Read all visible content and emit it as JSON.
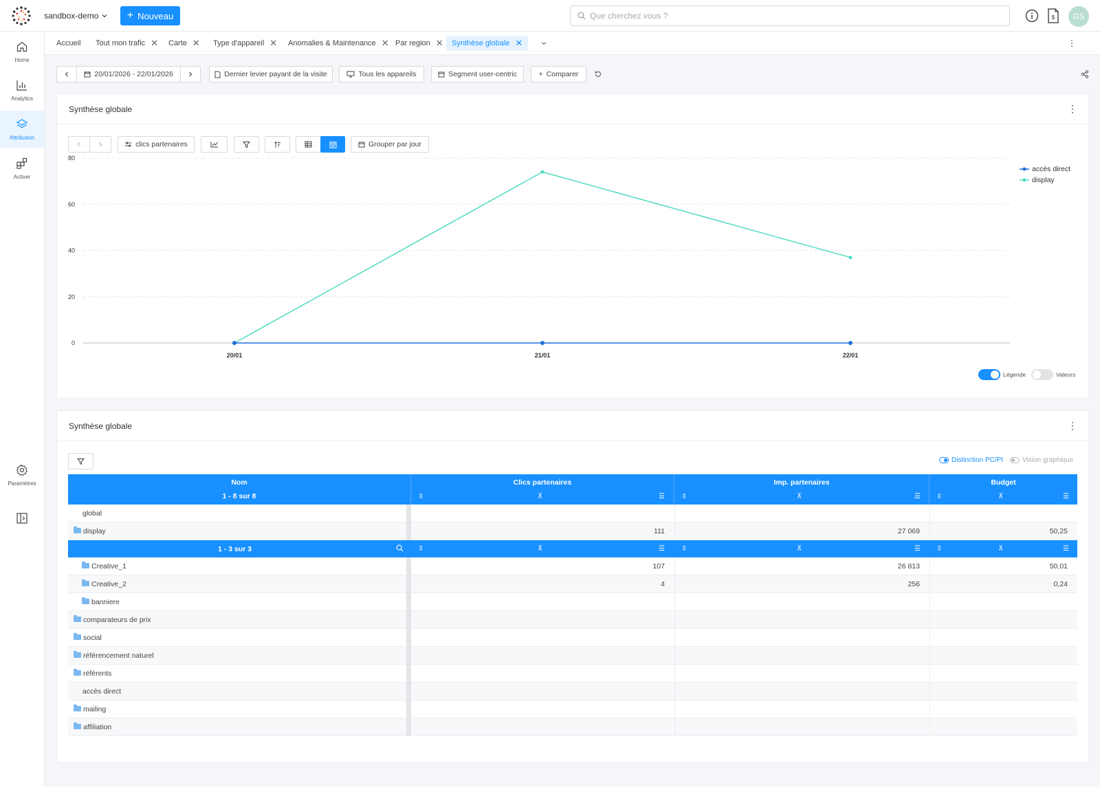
{
  "colors": {
    "accent": "#1890ff",
    "display_line": "#4fdcc1",
    "acces_line": "#1e6fd8"
  },
  "header": {
    "workspace": "sandbox-demo",
    "new_button": "Nouveau",
    "search_placeholder": "Que cherchez vous ?",
    "avatar_initials": "GS"
  },
  "sidebar": {
    "items": [
      {
        "label": "Home",
        "icon": "home-icon"
      },
      {
        "label": "Analytics",
        "icon": "bar-chart-icon"
      },
      {
        "label": "Attribution",
        "icon": "layers-icon"
      },
      {
        "label": "Activer",
        "icon": "apps-icon"
      }
    ],
    "settings_label": "Paramètres"
  },
  "tabs": [
    {
      "label": "Accueil",
      "closable": false
    },
    {
      "label": "Tout mon trafic",
      "closable": true
    },
    {
      "label": "Carte",
      "closable": true
    },
    {
      "label": "Type d'appareil",
      "closable": true
    },
    {
      "label": "Anomalies & Maintenance",
      "closable": true
    },
    {
      "label": "Par region",
      "closable": true
    },
    {
      "label": "Synthèse globale",
      "closable": true,
      "active": true
    }
  ],
  "toolbar": {
    "date_range": "20/01/2026 - 22/01/2026",
    "attribution_model": "Dernier levier payant de la visite",
    "devices": "Tous les appareils",
    "segment": "Segment user-centric",
    "compare": "Comparer"
  },
  "chart_panel": {
    "title": "Synthèse globale",
    "metric_button": "clics partenaires",
    "group_button": "Grouper par jour",
    "toggle_legend": "Légende",
    "toggle_values": "Valeurs"
  },
  "chart_data": {
    "type": "line",
    "x": [
      "20/01",
      "21/01",
      "22/01"
    ],
    "yticks": [
      "0",
      "20",
      "40",
      "60",
      "80"
    ],
    "ylim": [
      0,
      80
    ],
    "series": [
      {
        "name": "accès direct",
        "values": [
          0,
          0,
          0
        ],
        "color": "#1e6fd8"
      },
      {
        "name": "display",
        "values": [
          0,
          74,
          37
        ],
        "color": "#4fdcc1"
      }
    ],
    "legend": "top-right",
    "grid": true
  },
  "table_panel": {
    "title": "Synthèse globale",
    "distinction": "Distinction PC/PI",
    "vision": "Vision graphique",
    "columns": [
      "Nom",
      "Clics partenaires",
      "Imp. partenaires",
      "Budget"
    ],
    "name_subtitle": "1 - 8 sur 8",
    "sub_subtitle": "1 - 3 sur 3",
    "rows_top": [
      {
        "name": "global",
        "folder": false,
        "clics": "",
        "imp": "",
        "budget": ""
      },
      {
        "name": "display",
        "folder": true,
        "open": true,
        "clics": "111",
        "imp": "27 069",
        "budget": "50,25"
      }
    ],
    "rows_sub": [
      {
        "name": "Creative_1",
        "clics": "107",
        "imp": "26 813",
        "budget": "50,01"
      },
      {
        "name": "Creative_2",
        "clics": "4",
        "imp": "256",
        "budget": "0,24"
      },
      {
        "name": "banniere",
        "clics": "",
        "imp": "",
        "budget": ""
      }
    ],
    "rows_bottom": [
      {
        "name": "comparateurs de prix",
        "folder": true
      },
      {
        "name": "social",
        "folder": true
      },
      {
        "name": "référencement naturel",
        "folder": true
      },
      {
        "name": "référents",
        "folder": true
      },
      {
        "name": "accès direct",
        "folder": false
      },
      {
        "name": "mailing",
        "folder": true
      },
      {
        "name": "affiliation",
        "folder": true
      }
    ]
  }
}
